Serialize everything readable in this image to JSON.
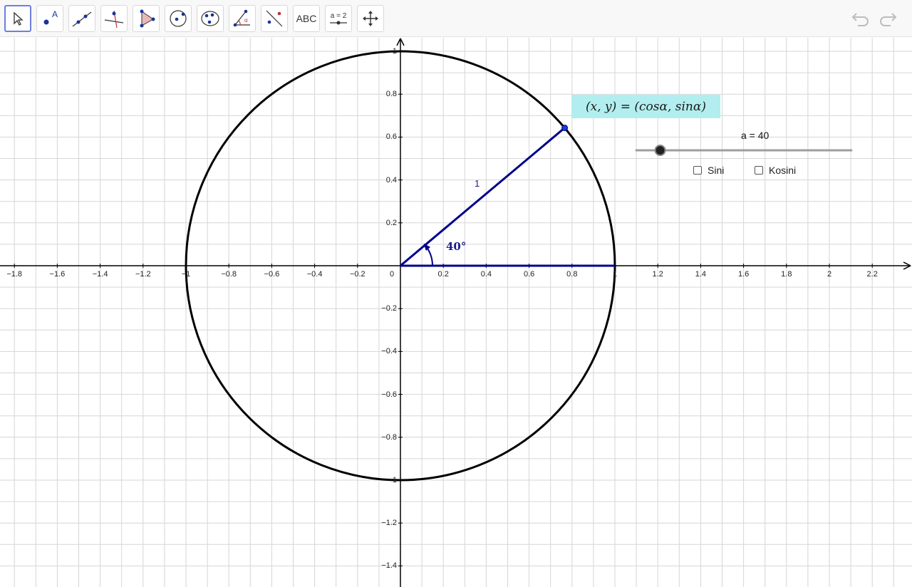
{
  "toolbar": {
    "tools": [
      {
        "name": "move-tool",
        "icon": "arrow-cursor-icon"
      },
      {
        "name": "point-tool",
        "icon": "point-icon",
        "label": "A"
      },
      {
        "name": "line-tool",
        "icon": "line-through-points-icon"
      },
      {
        "name": "perpendicular-tool",
        "icon": "perpendicular-line-icon"
      },
      {
        "name": "polygon-tool",
        "icon": "polygon-icon"
      },
      {
        "name": "circle-tool",
        "icon": "circle-center-point-icon"
      },
      {
        "name": "conic-tool",
        "icon": "circle-three-points-icon"
      },
      {
        "name": "angle-tool",
        "icon": "angle-icon"
      },
      {
        "name": "reflect-tool",
        "icon": "reflect-about-line-icon"
      },
      {
        "name": "text-tool",
        "icon": "text-icon",
        "label": "ABC"
      },
      {
        "name": "slider-tool",
        "icon": "slider-icon",
        "label": "a = 2"
      },
      {
        "name": "move-view-tool",
        "icon": "move-graphics-view-icon"
      }
    ],
    "undo_icon": "undo-icon",
    "redo_icon": "redo-icon"
  },
  "graph": {
    "x_ticks": [
      "−1.8",
      "−1.6",
      "−1.4",
      "−1.2",
      "−1",
      "−0.8",
      "−0.6",
      "−0.4",
      "−0.2",
      "0",
      "0.2",
      "0.4",
      "0.6",
      "0.8",
      "1",
      "1.2",
      "1.4",
      "1.6",
      "1.8",
      "2",
      "2.2"
    ],
    "y_ticks": [
      "1",
      "0.8",
      "0.6",
      "0.4",
      "0.2",
      "−0.2",
      "−0.4",
      "−0.6",
      "−0.8",
      "−1",
      "−1.2",
      "−1.4"
    ],
    "formula": "(x, y) = (cosα, sinα)",
    "segment_label": "1",
    "angle_label": "40°",
    "circle_radius": 1,
    "angle_degrees": 40,
    "point": {
      "x": 0.766,
      "y": 0.643
    },
    "colors": {
      "circle": "#000000",
      "segment": "#00008b",
      "formula_bg": "#b2eeef",
      "grid": "#d6d6d6"
    }
  },
  "slider": {
    "label": "a = 40",
    "value": 40,
    "min": 0,
    "max": 360
  },
  "checkboxes": [
    {
      "name": "sini-checkbox",
      "label": "Sini",
      "checked": false
    },
    {
      "name": "kosini-checkbox",
      "label": "Kosini",
      "checked": false
    }
  ]
}
